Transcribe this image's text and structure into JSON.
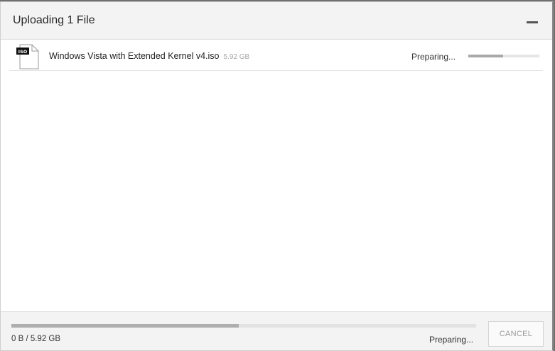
{
  "dialog": {
    "title": "Uploading 1 File",
    "minimize_icon": "minimize-icon"
  },
  "file": {
    "name": "Windows Vista with Extended Kernel v4.iso",
    "size": "5.92 GB",
    "type_label": "ISO",
    "status": "Preparing...",
    "progress_percent": 49
  },
  "footer": {
    "bytes": "0 B / 5.92 GB",
    "status": "Preparing...",
    "cancel_label": "CANCEL",
    "progress_percent": 49
  },
  "colors": {
    "header_bg": "#f3f3f3",
    "progress_fill": "#a9a9a9",
    "progress_track": "#e4e4e4"
  }
}
